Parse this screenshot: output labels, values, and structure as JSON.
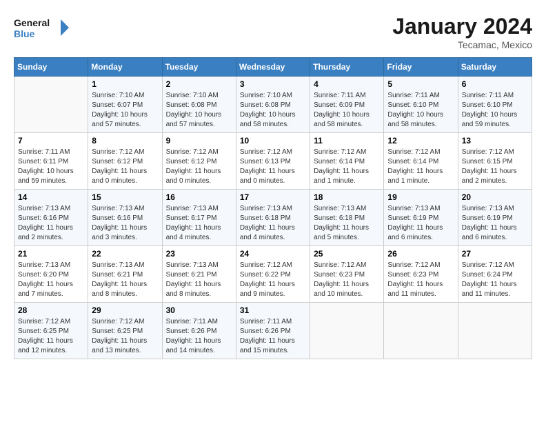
{
  "header": {
    "logo_line1": "General",
    "logo_line2": "Blue",
    "month_year": "January 2024",
    "location": "Tecamac, Mexico"
  },
  "weekdays": [
    "Sunday",
    "Monday",
    "Tuesday",
    "Wednesday",
    "Thursday",
    "Friday",
    "Saturday"
  ],
  "weeks": [
    [
      {
        "day": "",
        "info": ""
      },
      {
        "day": "1",
        "info": "Sunrise: 7:10 AM\nSunset: 6:07 PM\nDaylight: 10 hours\nand 57 minutes."
      },
      {
        "day": "2",
        "info": "Sunrise: 7:10 AM\nSunset: 6:08 PM\nDaylight: 10 hours\nand 57 minutes."
      },
      {
        "day": "3",
        "info": "Sunrise: 7:10 AM\nSunset: 6:08 PM\nDaylight: 10 hours\nand 58 minutes."
      },
      {
        "day": "4",
        "info": "Sunrise: 7:11 AM\nSunset: 6:09 PM\nDaylight: 10 hours\nand 58 minutes."
      },
      {
        "day": "5",
        "info": "Sunrise: 7:11 AM\nSunset: 6:10 PM\nDaylight: 10 hours\nand 58 minutes."
      },
      {
        "day": "6",
        "info": "Sunrise: 7:11 AM\nSunset: 6:10 PM\nDaylight: 10 hours\nand 59 minutes."
      }
    ],
    [
      {
        "day": "7",
        "info": "Sunrise: 7:11 AM\nSunset: 6:11 PM\nDaylight: 10 hours\nand 59 minutes."
      },
      {
        "day": "8",
        "info": "Sunrise: 7:12 AM\nSunset: 6:12 PM\nDaylight: 11 hours\nand 0 minutes."
      },
      {
        "day": "9",
        "info": "Sunrise: 7:12 AM\nSunset: 6:12 PM\nDaylight: 11 hours\nand 0 minutes."
      },
      {
        "day": "10",
        "info": "Sunrise: 7:12 AM\nSunset: 6:13 PM\nDaylight: 11 hours\nand 0 minutes."
      },
      {
        "day": "11",
        "info": "Sunrise: 7:12 AM\nSunset: 6:14 PM\nDaylight: 11 hours\nand 1 minute."
      },
      {
        "day": "12",
        "info": "Sunrise: 7:12 AM\nSunset: 6:14 PM\nDaylight: 11 hours\nand 1 minute."
      },
      {
        "day": "13",
        "info": "Sunrise: 7:12 AM\nSunset: 6:15 PM\nDaylight: 11 hours\nand 2 minutes."
      }
    ],
    [
      {
        "day": "14",
        "info": "Sunrise: 7:13 AM\nSunset: 6:16 PM\nDaylight: 11 hours\nand 2 minutes."
      },
      {
        "day": "15",
        "info": "Sunrise: 7:13 AM\nSunset: 6:16 PM\nDaylight: 11 hours\nand 3 minutes."
      },
      {
        "day": "16",
        "info": "Sunrise: 7:13 AM\nSunset: 6:17 PM\nDaylight: 11 hours\nand 4 minutes."
      },
      {
        "day": "17",
        "info": "Sunrise: 7:13 AM\nSunset: 6:18 PM\nDaylight: 11 hours\nand 4 minutes."
      },
      {
        "day": "18",
        "info": "Sunrise: 7:13 AM\nSunset: 6:18 PM\nDaylight: 11 hours\nand 5 minutes."
      },
      {
        "day": "19",
        "info": "Sunrise: 7:13 AM\nSunset: 6:19 PM\nDaylight: 11 hours\nand 6 minutes."
      },
      {
        "day": "20",
        "info": "Sunrise: 7:13 AM\nSunset: 6:19 PM\nDaylight: 11 hours\nand 6 minutes."
      }
    ],
    [
      {
        "day": "21",
        "info": "Sunrise: 7:13 AM\nSunset: 6:20 PM\nDaylight: 11 hours\nand 7 minutes."
      },
      {
        "day": "22",
        "info": "Sunrise: 7:13 AM\nSunset: 6:21 PM\nDaylight: 11 hours\nand 8 minutes."
      },
      {
        "day": "23",
        "info": "Sunrise: 7:13 AM\nSunset: 6:21 PM\nDaylight: 11 hours\nand 8 minutes."
      },
      {
        "day": "24",
        "info": "Sunrise: 7:12 AM\nSunset: 6:22 PM\nDaylight: 11 hours\nand 9 minutes."
      },
      {
        "day": "25",
        "info": "Sunrise: 7:12 AM\nSunset: 6:23 PM\nDaylight: 11 hours\nand 10 minutes."
      },
      {
        "day": "26",
        "info": "Sunrise: 7:12 AM\nSunset: 6:23 PM\nDaylight: 11 hours\nand 11 minutes."
      },
      {
        "day": "27",
        "info": "Sunrise: 7:12 AM\nSunset: 6:24 PM\nDaylight: 11 hours\nand 11 minutes."
      }
    ],
    [
      {
        "day": "28",
        "info": "Sunrise: 7:12 AM\nSunset: 6:25 PM\nDaylight: 11 hours\nand 12 minutes."
      },
      {
        "day": "29",
        "info": "Sunrise: 7:12 AM\nSunset: 6:25 PM\nDaylight: 11 hours\nand 13 minutes."
      },
      {
        "day": "30",
        "info": "Sunrise: 7:11 AM\nSunset: 6:26 PM\nDaylight: 11 hours\nand 14 minutes."
      },
      {
        "day": "31",
        "info": "Sunrise: 7:11 AM\nSunset: 6:26 PM\nDaylight: 11 hours\nand 15 minutes."
      },
      {
        "day": "",
        "info": ""
      },
      {
        "day": "",
        "info": ""
      },
      {
        "day": "",
        "info": ""
      }
    ]
  ]
}
